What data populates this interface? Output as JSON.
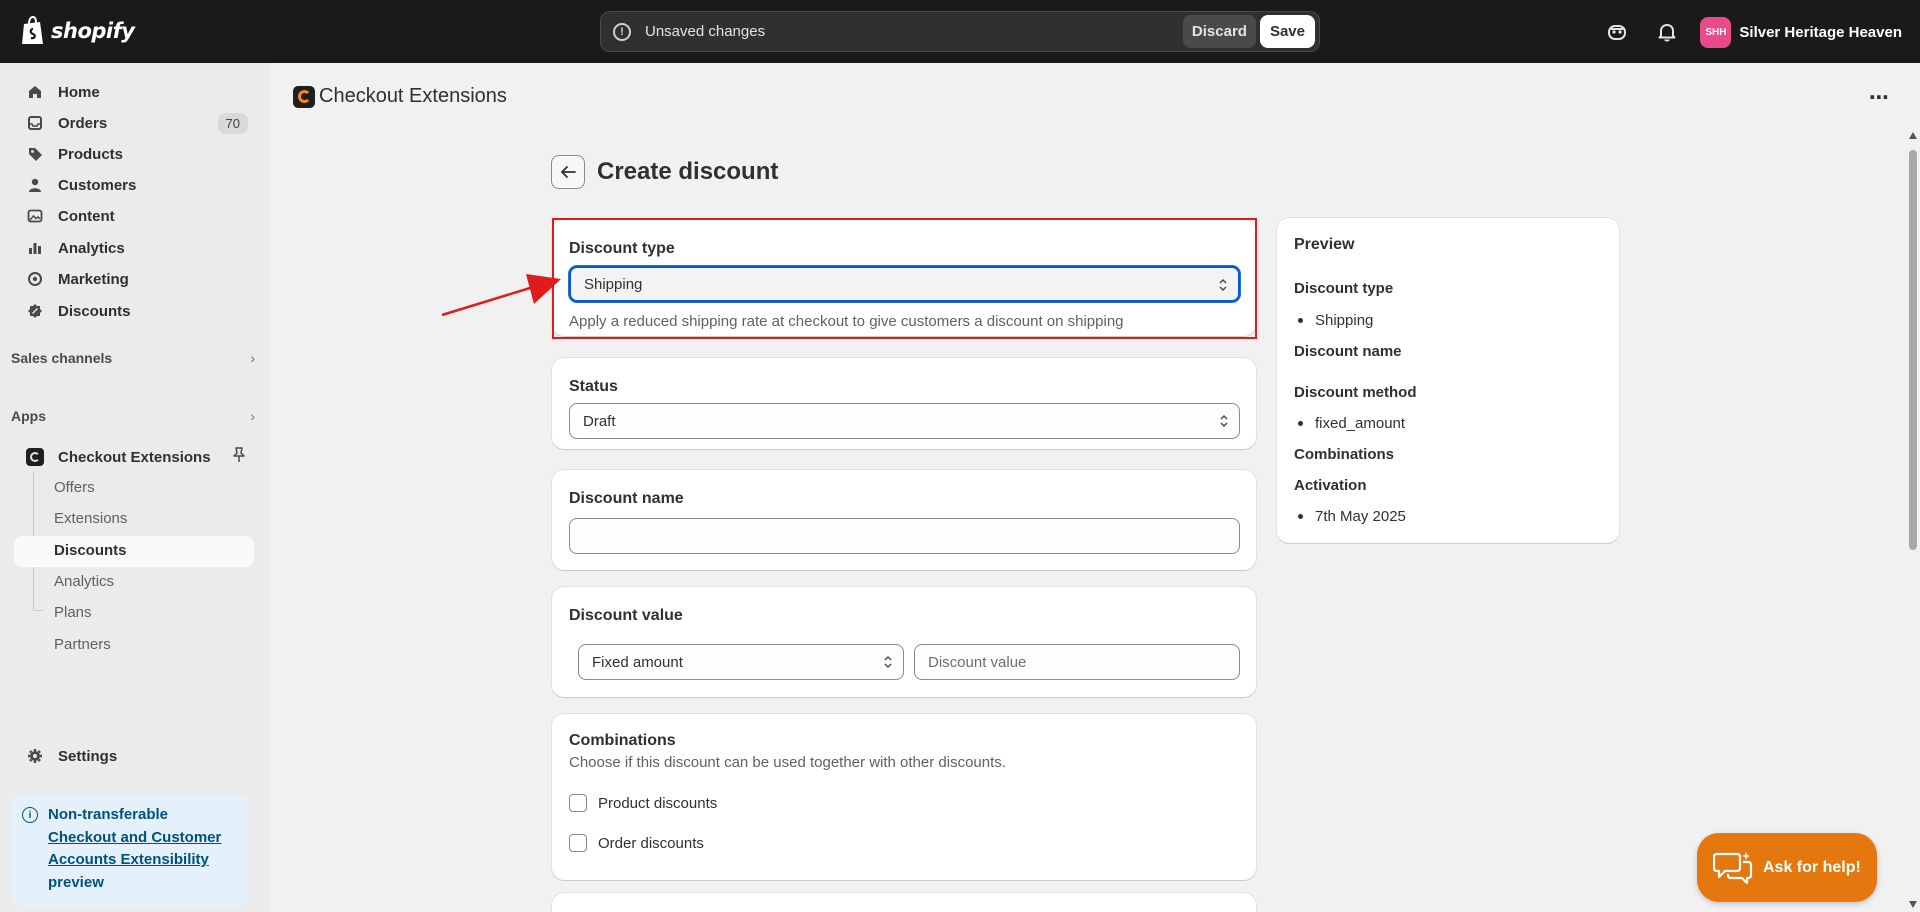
{
  "topbar": {
    "logo_text": "shopify",
    "unsaved_text": "Unsaved changes",
    "discard_label": "Discard",
    "save_label": "Save",
    "avatar_initials": "SHH",
    "store_name": "Silver Heritage Heaven"
  },
  "sidebar": {
    "items": [
      {
        "label": "Home",
        "icon": "home-icon"
      },
      {
        "label": "Orders",
        "icon": "orders-icon",
        "badge": "70"
      },
      {
        "label": "Products",
        "icon": "tag-icon"
      },
      {
        "label": "Customers",
        "icon": "person-icon"
      },
      {
        "label": "Content",
        "icon": "content-icon"
      },
      {
        "label": "Analytics",
        "icon": "bar-chart-icon"
      },
      {
        "label": "Marketing",
        "icon": "target-icon"
      },
      {
        "label": "Discounts",
        "icon": "discount-icon"
      }
    ],
    "sales_channels_label": "Sales channels",
    "apps_label": "Apps",
    "app_name": "Checkout Extensions",
    "app_subitems": [
      "Offers",
      "Extensions",
      "Discounts",
      "Analytics",
      "Plans",
      "Partners"
    ],
    "settings_label": "Settings",
    "notice": {
      "line1": "Non-transferable",
      "link": "Checkout and Customer Accounts Extensibility",
      "line_end": "preview"
    }
  },
  "main": {
    "app_title": "Checkout Extensions",
    "page_title": "Create discount",
    "discount_type": {
      "label": "Discount type",
      "value": "Shipping",
      "help": "Apply a reduced shipping rate at checkout to give customers a discount on shipping"
    },
    "status": {
      "label": "Status",
      "value": "Draft"
    },
    "discount_name": {
      "label": "Discount name",
      "value": ""
    },
    "discount_value": {
      "label": "Discount value",
      "method": "Fixed amount",
      "placeholder": "Discount value"
    },
    "combinations": {
      "label": "Combinations",
      "help": "Choose if this discount can be used together with other discounts.",
      "options": [
        "Product discounts",
        "Order discounts"
      ]
    },
    "preview": {
      "title": "Preview",
      "type_label": "Discount type",
      "type_value": "Shipping",
      "name_label": "Discount name",
      "method_label": "Discount method",
      "method_value": "fixed_amount",
      "combinations_label": "Combinations",
      "activation_label": "Activation",
      "activation_value": "7th May 2025"
    },
    "help_button": "Ask for help!"
  },
  "colors": {
    "highlight": "#e01b1b",
    "focus": "#005bd3",
    "help_button": "#e4780f"
  }
}
